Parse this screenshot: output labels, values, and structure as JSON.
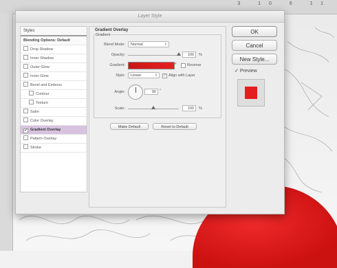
{
  "window": {
    "title": "Layer Style"
  },
  "ruler": {
    "numbers": "3 10 6 11"
  },
  "styles_panel": {
    "header": "Styles",
    "items": [
      {
        "label": "Blending Options: Default",
        "checked": false,
        "indent": false,
        "first": true
      },
      {
        "label": "Drop Shadow",
        "checked": false,
        "indent": false
      },
      {
        "label": "Inner Shadow",
        "checked": false,
        "indent": false
      },
      {
        "label": "Outer Glow",
        "checked": false,
        "indent": false
      },
      {
        "label": "Inner Glow",
        "checked": false,
        "indent": false
      },
      {
        "label": "Bevel and Emboss",
        "checked": false,
        "indent": false
      },
      {
        "label": "Contour",
        "checked": false,
        "indent": true
      },
      {
        "label": "Texture",
        "checked": false,
        "indent": true
      },
      {
        "label": "Satin",
        "checked": false,
        "indent": false
      },
      {
        "label": "Color Overlay",
        "checked": false,
        "indent": false
      },
      {
        "label": "Gradient Overlay",
        "checked": true,
        "indent": false,
        "selected": true
      },
      {
        "label": "Pattern Overlay",
        "checked": false,
        "indent": false
      },
      {
        "label": "Stroke",
        "checked": false,
        "indent": false
      }
    ]
  },
  "gradient_overlay": {
    "group_title": "Gradient Overlay",
    "subgroup_title": "Gradient",
    "blend_mode": {
      "label": "Blend Mode:",
      "value": "Normal"
    },
    "opacity": {
      "label": "Opacity:",
      "value": "100",
      "unit": "%",
      "level": 1.0
    },
    "gradient": {
      "label": "Gradient:",
      "reverse_label": "Reverse"
    },
    "style": {
      "label": "Style:",
      "value": "Linear",
      "align_label": "Align with Layer"
    },
    "angle": {
      "label": "Angle:",
      "value": "90"
    },
    "scale": {
      "label": "Scale:",
      "value": "100",
      "unit": "%",
      "level": 0.5
    },
    "make_default": "Make Default",
    "reset_default": "Reset to Default"
  },
  "buttons": {
    "ok": "OK",
    "cancel": "Cancel",
    "new_style": "New Style...",
    "preview": "Preview"
  },
  "colors": {
    "gradient_start": "#c81616",
    "gradient_end": "#e82020",
    "preview": "#e41e1e",
    "selected_row": "#d7c3e0"
  }
}
